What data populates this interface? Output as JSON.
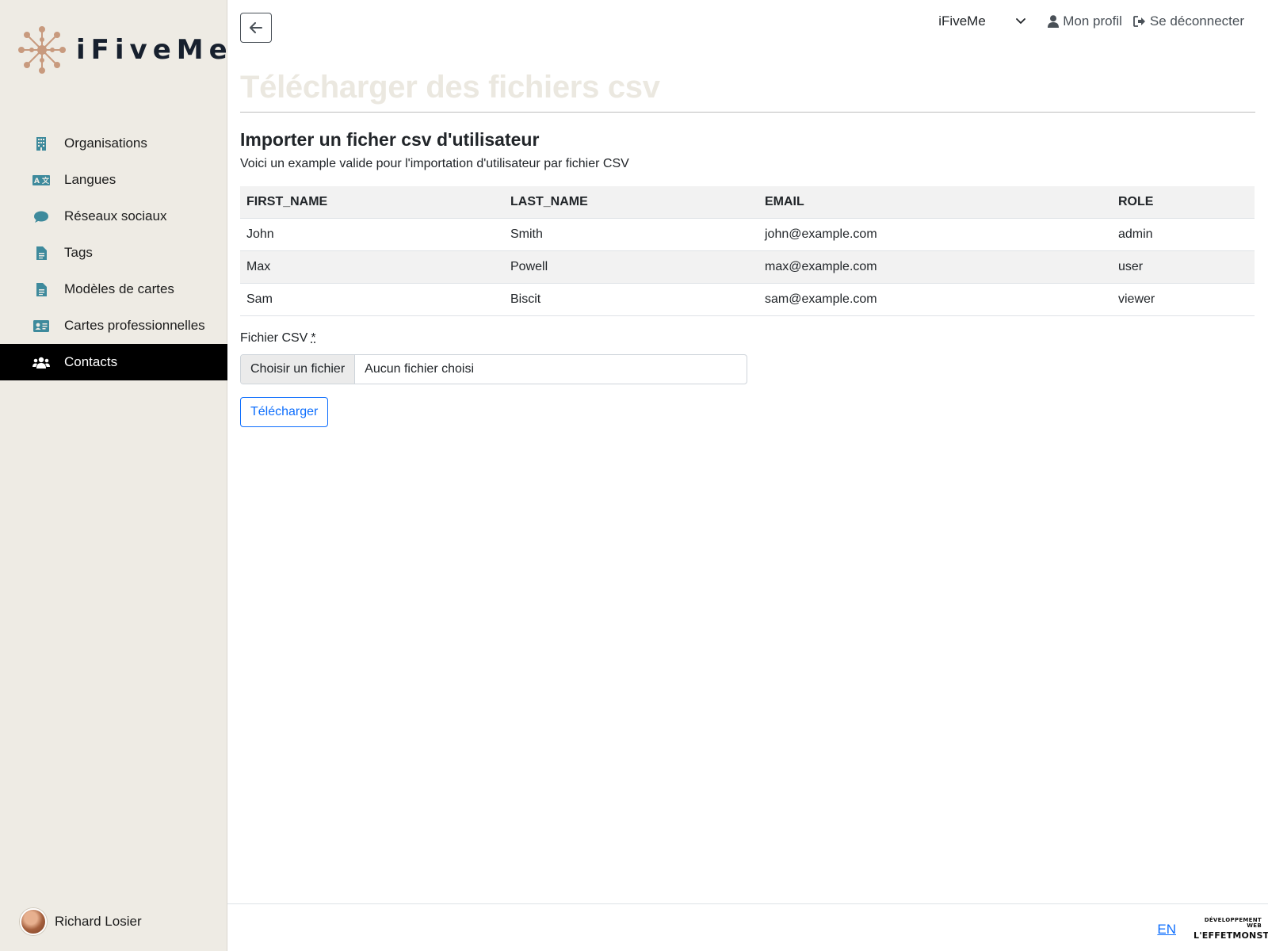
{
  "brand": {
    "name": "iFiveMe",
    "accent": "#c89a7e",
    "text_color": "#17202e"
  },
  "sidebar": {
    "items": [
      {
        "label": "Organisations",
        "icon": "building-icon",
        "active": false
      },
      {
        "label": "Langues",
        "icon": "language-icon",
        "active": false
      },
      {
        "label": "Réseaux sociaux",
        "icon": "comment-icon",
        "active": false
      },
      {
        "label": "Tags",
        "icon": "file-text-icon",
        "active": false
      },
      {
        "label": "Modèles de cartes",
        "icon": "file-text-icon",
        "active": false
      },
      {
        "label": "Cartes professionnelles",
        "icon": "id-card-icon",
        "active": false
      },
      {
        "label": "Contacts",
        "icon": "users-icon",
        "active": true
      }
    ],
    "user": {
      "name": "Richard Losier"
    }
  },
  "topbar": {
    "organization_selected": "iFiveMe",
    "profile_label": "Mon profil",
    "logout_label": "Se déconnecter"
  },
  "page": {
    "title": "Télécharger des fichiers csv",
    "section_title": "Importer un ficher csv d'utilisateur",
    "section_desc": "Voici un example valide pour l'importation d'utilisateur par fichier CSV"
  },
  "example_table": {
    "headers": [
      "FIRST_NAME",
      "LAST_NAME",
      "EMAIL",
      "ROLE"
    ],
    "rows": [
      [
        "John",
        "Smith",
        "john@example.com",
        "admin"
      ],
      [
        "Max",
        "Powell",
        "max@example.com",
        "user"
      ],
      [
        "Sam",
        "Biscit",
        "sam@example.com",
        "viewer"
      ]
    ]
  },
  "form": {
    "file_label": "Fichier CSV",
    "required_marker": "*",
    "choose_button": "Choisir un fichier",
    "no_file_text": "Aucun fichier choisi",
    "submit_label": "Télécharger"
  },
  "footer": {
    "language_link": "EN",
    "credit_small": "DÉVELOPPEMENT WEB",
    "credit_big": "L'EFFETMONSTRE"
  },
  "colors": {
    "sidebar_bg": "#eeebe4",
    "icon_teal": "#3e8a9c",
    "active_bg": "#000000",
    "primary": "#0d6efd",
    "title_faded": "#ebe8e0"
  }
}
